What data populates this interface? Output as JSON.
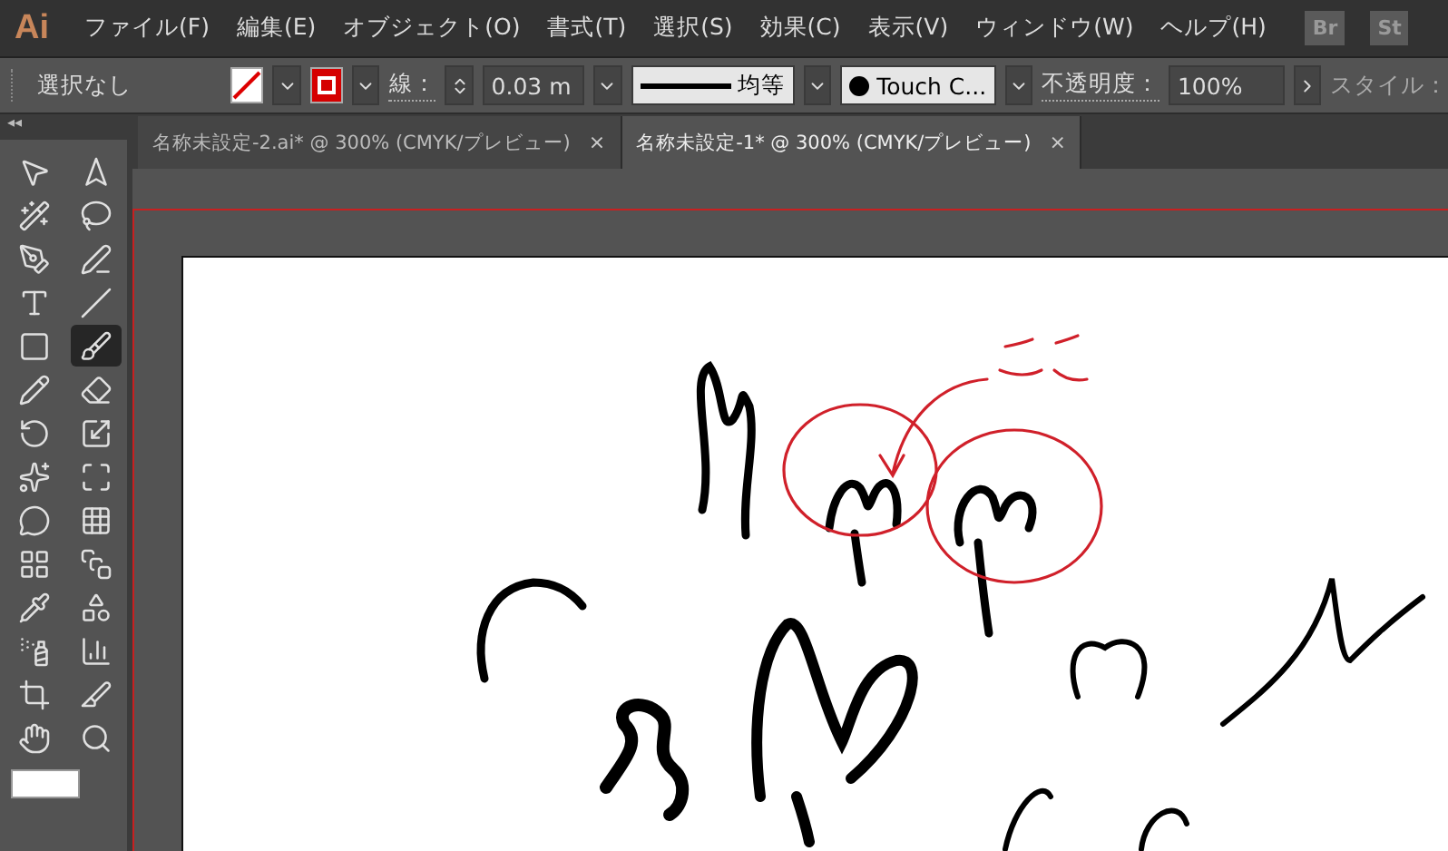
{
  "app": {
    "logo": "Ai",
    "menu": [
      "ファイル(F)",
      "編集(E)",
      "オブジェクト(O)",
      "書式(T)",
      "選択(S)",
      "効果(C)",
      "表示(V)",
      "ウィンドウ(W)",
      "ヘルプ(H)"
    ],
    "bridges": [
      "Br",
      "St"
    ]
  },
  "control_bar": {
    "selection": "選択なし",
    "stroke_label": "線：",
    "stroke_weight": "0.03 m",
    "profile": "均等",
    "brush": "Touch C...",
    "opacity_label": "不透明度：",
    "opacity": "100%",
    "style_label": "スタイル："
  },
  "tabs": [
    {
      "label": "名称未設定-2.ai* @ 300% (CMYK/プレビュー)",
      "selected": false,
      "close": "×"
    },
    {
      "label": "名称未設定-1* @ 300% (CMYK/プレビュー)",
      "selected": true,
      "close": "×"
    }
  ],
  "toolbox": {
    "collapse": "◂◂",
    "tools": [
      {
        "selected": false
      },
      {
        "selected": false
      },
      {
        "selected": false
      },
      {
        "selected": false
      },
      {
        "selected": false
      },
      {
        "selected": false
      },
      {
        "selected": false
      },
      {
        "selected": false
      },
      {
        "selected": false
      },
      {
        "selected": true
      },
      {
        "selected": false
      },
      {
        "selected": false
      },
      {
        "selected": false
      },
      {
        "selected": false
      },
      {
        "selected": false
      },
      {
        "selected": false
      },
      {
        "selected": false
      },
      {
        "selected": false
      },
      {
        "selected": false
      },
      {
        "selected": false
      },
      {
        "selected": false
      },
      {
        "selected": false
      },
      {
        "selected": false
      },
      {
        "selected": false
      },
      {
        "selected": false
      },
      {
        "selected": false
      },
      {
        "selected": false
      },
      {
        "selected": false
      }
    ]
  }
}
